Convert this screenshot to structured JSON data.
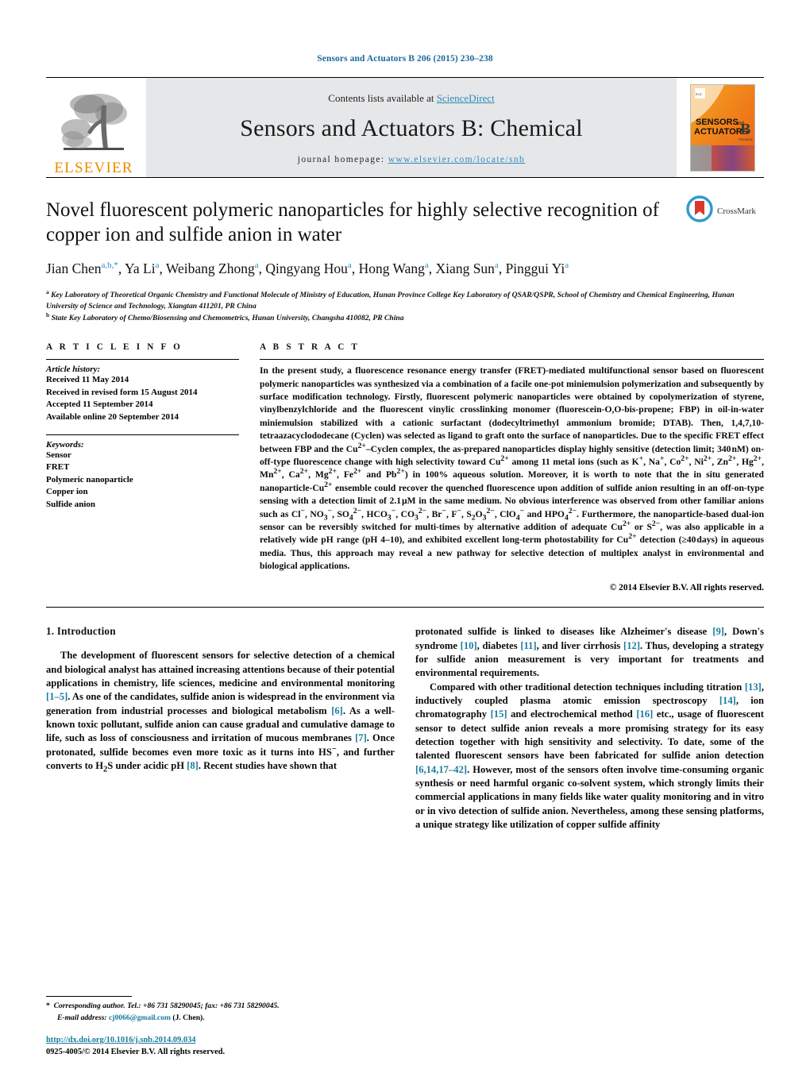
{
  "running_head": "Sensors and Actuators B 206 (2015) 230–238",
  "masthead": {
    "publisher_wordmark": "ELSEVIER",
    "publisher_logo_icon": "elsevier-tree-icon",
    "contents_prefix": "Contents lists available at ",
    "contents_link": "ScienceDirect",
    "journal_title": "Sensors and Actuators B: Chemical",
    "homepage_prefix": "journal homepage: ",
    "homepage_url": "www.elsevier.com/locate/snb",
    "cover_title_line1": "SENSORS",
    "cover_title_and": "and",
    "cover_title_line2": "ACTUATORS",
    "cover_letter": "B",
    "cover_sub": "Chemical",
    "cover_icon": "journal-cover-thumbnail"
  },
  "article": {
    "title": "Novel fluorescent polymeric nanoparticles for highly selective recognition of copper ion and sulfide anion in water",
    "crossmark_label": "CrossMark",
    "crossmark_icon": "crossmark-icon",
    "authors_html": "Jian Chen<sup>a,b,</sup><sup class=\"star\">*</sup>, Ya Li<sup>a</sup>, Weibang Zhong<sup>a</sup>, Qingyang Hou<sup>a</sup>, Hong Wang<sup>a</sup>, Xiang Sun<sup>a</sup>, Pinggui Yi<sup>a</sup>",
    "affiliations": [
      "Key Laboratory of Theoretical Organic Chemistry and Functional Molecule of Ministry of Education, Hunan Province College Key Laboratory of QSAR/QSPR, School of Chemistry and Chemical Engineering, Hunan University of Science and Technology, Xiangtan 411201, PR China",
      "State Key Laboratory of Chemo/Biosensing and Chemometrics, Hunan University, Changsha 410082, PR China"
    ],
    "affiliation_marks": [
      "a",
      "b"
    ]
  },
  "article_info": {
    "heading": "A R T I C L E    I N F O",
    "history_label": "Article history:",
    "history": [
      "Received 11 May 2014",
      "Received in revised form 15 August 2014",
      "Accepted 11 September 2014",
      "Available online 20 September 2014"
    ],
    "keywords_label": "Keywords:",
    "keywords": [
      "Sensor",
      "FRET",
      "Polymeric nanoparticle",
      "Copper ion",
      "Sulfide anion"
    ]
  },
  "abstract": {
    "heading": "A B S T R A C T",
    "text_html": "In the present study, a fluorescence resonance energy transfer (FRET)-mediated multifunctional sensor based on fluorescent polymeric nanoparticles was synthesized via a combination of a facile one-pot miniemulsion polymerization and subsequently by surface modification technology. Firstly, fluorescent polymeric nanoparticles were obtained by copolymerization of styrene, vinylbenzylchloride and the fluorescent vinylic crosslinking monomer (fluorescein-O,O-bis-propene; FBP) in oil-in-water miniemulsion stabilized with a cationic surfactant (dodecyltrimethyl ammonium bromide; DTAB). Then, 1,4,7,10-tetraazacyclododecane (Cyclen) was selected as ligand to graft onto the surface of nanoparticles. Due to the specific FRET effect between FBP and the Cu<sup>2+</sup>–Cyclen complex, the as-prepared nanoparticles display highly sensitive (detection limit; 340&#8202;nM) on-off-type fluorescence change with high selectivity toward Cu<sup>2+</sup> among 11 metal ions (such as K<sup>+</sup>, Na<sup>+</sup>, Co<sup>2+</sup>, Ni<sup>2+</sup>, Zn<sup>2+</sup>, Hg<sup>2+</sup>, Mn<sup>2+</sup>, Ca<sup>2+</sup>, Mg<sup>2+</sup>, Fe<sup>2+</sup> and Pb<sup>2+</sup>) in 100% aqueous solution. Moreover, it is worth to note that the in situ generated nanoparticle-Cu<sup>2+</sup> ensemble could recover the quenched fluorescence upon addition of sulfide anion resulting in an off-on-type sensing with a detection limit of 2.1&#8202;&micro;M in the same medium. No obvious interference was observed from other familiar anions such as Cl<sup>−</sup>, NO<sub>3</sub><sup>−</sup>, SO<sub>4</sub><sup>2−</sup>, HCO<sub>3</sub><sup>−</sup>, CO<sub>3</sub><sup>2−</sup>, Br<sup>−</sup>, F<sup>−</sup>, S<sub>2</sub>O<sub>3</sub><sup>2−</sup>, ClO<sub>4</sub><sup>−</sup> and HPO<sub>4</sub><sup>2−</sup>. Furthermore, the nanoparticle-based dual-ion sensor can be reversibly switched for multi-times by alternative addition of adequate Cu<sup>2+</sup> or S<sup>2−</sup>, was also applicable in a relatively wide pH range (pH 4–10), and exhibited excellent long-term photostability for Cu<sup>2+</sup> detection (&ge;40&#8202;days) in aqueous media. Thus, this approach may reveal a new pathway for selective detection of multiplex analyst in environmental and biological applications.",
    "copyright": "© 2014 Elsevier B.V. All rights reserved."
  },
  "introduction": {
    "heading": "1.  Introduction",
    "paragraphs_html": [
      "The development of fluorescent sensors for selective detection of a chemical and biological analyst has attained increasing attentions because of their potential applications in chemistry, life sciences, medicine and environmental monitoring <span class=\"ref\">[1–5]</span>. As one of the candidates, sulfide anion is widespread in the environment via generation from industrial processes and biological metabolism <span class=\"ref\">[6]</span>. As a well-known toxic pollutant, sulfide anion can cause gradual and cumulative damage to life, such as loss of consciousness and irritation of mucous membranes <span class=\"ref\">[7]</span>. Once protonated, sulfide becomes even more toxic as it turns into HS<sup>−</sup>, and further converts to H<sub>2</sub>S under acidic pH <span class=\"ref\">[8]</span>. Recent studies have shown that"
    ],
    "paragraphs_right_html": [
      "protonated sulfide is linked to diseases like Alzheimer's disease <span class=\"ref\">[9]</span>, Down's syndrome <span class=\"ref\">[10]</span>, diabetes <span class=\"ref\">[11]</span>, and liver cirrhosis <span class=\"ref\">[12]</span>. Thus, developing a strategy for sulfide anion measurement is very important for treatments and environmental requirements.",
      "Compared with other traditional detection techniques including titration <span class=\"ref\">[13]</span>, inductively coupled plasma atomic emission spectroscopy <span class=\"ref\">[14]</span>, ion chromatography <span class=\"ref\">[15]</span> and electrochemical method <span class=\"ref\">[16]</span> etc., usage of fluorescent sensor to detect sulfide anion reveals a more promising strategy for its easy detection together with high sensitivity and selectivity. To date, some of the talented fluorescent sensors have been fabricated for sulfide anion detection <span class=\"ref\">[6,14,17–42]</span>. However, most of the sensors often involve time-consuming organic synthesis or need harmful organic co-solvent system, which strongly limits their commercial applications in many fields like water quality monitoring and in vitro or in vivo detection of sulfide anion. Nevertheless, among these sensing platforms, a unique strategy like utilization of copper sulfide affinity"
    ]
  },
  "footnotes": {
    "corresponding_html": "<span>*</span>&nbsp; <span class=\"ital\">Corresponding author. Tel.: +86 731 58290045; fax: +86 731 58290045.</span>",
    "email_label": "E-mail address:",
    "email": "cj0066@gmail.com",
    "email_suffix": "(J. Chen).",
    "doi": "http://dx.doi.org/10.1016/j.snb.2014.09.034",
    "issn_line": "0925-4005/© 2014 Elsevier B.V. All rights reserved."
  },
  "colors": {
    "link_blue": "#1a7b9e",
    "sciencedirect_blue": "#2e8bc0",
    "elsevier_orange": "#ED8B00",
    "band_grey": "#e6e7e8"
  }
}
